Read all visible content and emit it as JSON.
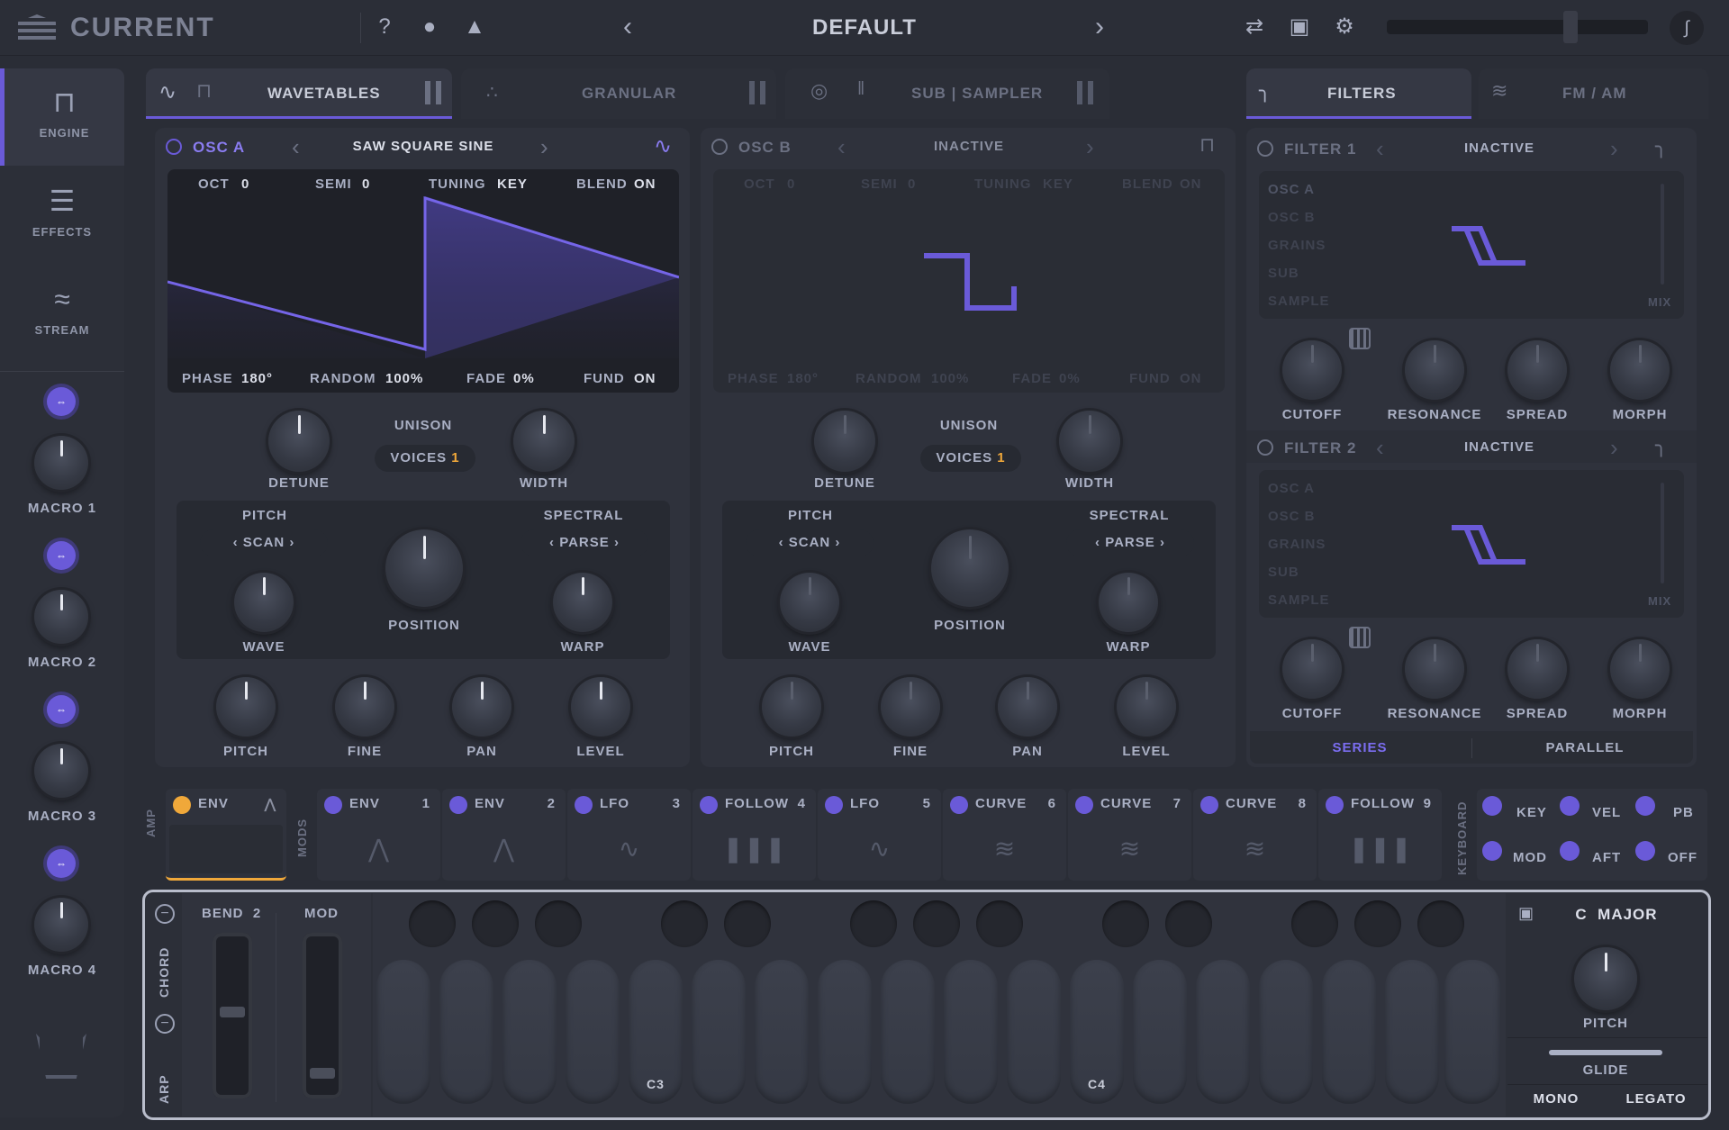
{
  "app": {
    "title": "CURRENT",
    "preset": "DEFAULT"
  },
  "top_icons": [
    "help-icon",
    "user-icon",
    "bell-icon",
    "shuffle-icon",
    "save-icon",
    "gear-icon",
    "curve-icon"
  ],
  "sidebar": {
    "tabs": [
      {
        "label": "ENGINE"
      },
      {
        "label": "EFFECTS"
      },
      {
        "label": "STREAM"
      }
    ],
    "macros": [
      "MACRO 1",
      "MACRO 2",
      "MACRO 3",
      "MACRO 4"
    ]
  },
  "tabs": {
    "wavetables": "WAVETABLES",
    "granular": "GRANULAR",
    "sub_sampler": "SUB | SAMPLER",
    "filters": "FILTERS",
    "fm_am": "FM / AM"
  },
  "osc_a": {
    "name": "OSC A",
    "wave": "SAW SQUARE SINE",
    "top": {
      "oct_label": "OCT",
      "oct": "0",
      "semi_label": "SEMI",
      "semi": "0",
      "tuning_label": "TUNING",
      "tuning": "KEY",
      "blend_label": "BLEND",
      "blend": "ON"
    },
    "bottom": {
      "phase_label": "PHASE",
      "phase": "180°",
      "random_label": "RANDOM",
      "random": "100%",
      "fade_label": "FADE",
      "fade": "0%",
      "fund_label": "FUND",
      "fund": "ON"
    }
  },
  "osc_b": {
    "name": "OSC B",
    "wave": "INACTIVE",
    "top": {
      "oct_label": "OCT",
      "oct": "0",
      "semi_label": "SEMI",
      "semi": "0",
      "tuning_label": "TUNING",
      "tuning": "KEY",
      "blend_label": "BLEND",
      "blend": "ON"
    },
    "bottom": {
      "phase_label": "PHASE",
      "phase": "180°",
      "random_label": "RANDOM",
      "random": "100%",
      "fade_label": "FADE",
      "fade": "0%",
      "fund_label": "FUND",
      "fund": "ON"
    }
  },
  "osc_common": {
    "detune": "DETUNE",
    "unison": "UNISON",
    "voices_label": "VOICES",
    "voices": "1",
    "width": "WIDTH",
    "pitch_header": "PITCH",
    "spectral_header": "SPECTRAL",
    "scan": "SCAN",
    "parse": "PARSE",
    "wave": "WAVE",
    "position": "POSITION",
    "warp": "WARP",
    "pitch": "PITCH",
    "fine": "FINE",
    "pan": "PAN",
    "level": "LEVEL"
  },
  "filter1": {
    "name": "FILTER 1",
    "type": "INACTIVE"
  },
  "filter2": {
    "name": "FILTER 2",
    "type": "INACTIVE"
  },
  "filter_common": {
    "sources": [
      "OSC A",
      "OSC B",
      "GRAINS",
      "SUB",
      "SAMPLE"
    ],
    "mix": "MIX",
    "cutoff": "CUTOFF",
    "resonance": "RESONANCE",
    "spread": "SPREAD",
    "morph": "MORPH"
  },
  "routing": {
    "series": "SERIES",
    "parallel": "PARALLEL"
  },
  "amp": {
    "side": "AMP",
    "label": "ENV"
  },
  "mods": {
    "side": "MODS",
    "slots": [
      {
        "label": "ENV",
        "num": "1"
      },
      {
        "label": "ENV",
        "num": "2"
      },
      {
        "label": "LFO",
        "num": "3"
      },
      {
        "label": "FOLLOW",
        "num": "4"
      },
      {
        "label": "LFO",
        "num": "5"
      },
      {
        "label": "CURVE",
        "num": "6"
      },
      {
        "label": "CURVE",
        "num": "7"
      },
      {
        "label": "CURVE",
        "num": "8"
      },
      {
        "label": "FOLLOW",
        "num": "9"
      }
    ]
  },
  "keyboard_mods": {
    "side": "KEYBOARD",
    "items": [
      "KEY",
      "VEL",
      "PB",
      "MOD",
      "AFT",
      "OFF"
    ]
  },
  "perform": {
    "chord": "CHORD",
    "arp": "ARP",
    "bend_label": "BEND",
    "bend": "2",
    "mod": "MOD",
    "c3": "C3",
    "c4": "C4"
  },
  "scale": {
    "root": "C",
    "name": "MAJOR",
    "pitch": "PITCH",
    "glide": "GLIDE",
    "mono": "MONO",
    "legato": "LEGATO"
  },
  "colors": {
    "accent": "#6a5ad8",
    "amber": "#f0a83a",
    "bg": "#2a2d36"
  }
}
